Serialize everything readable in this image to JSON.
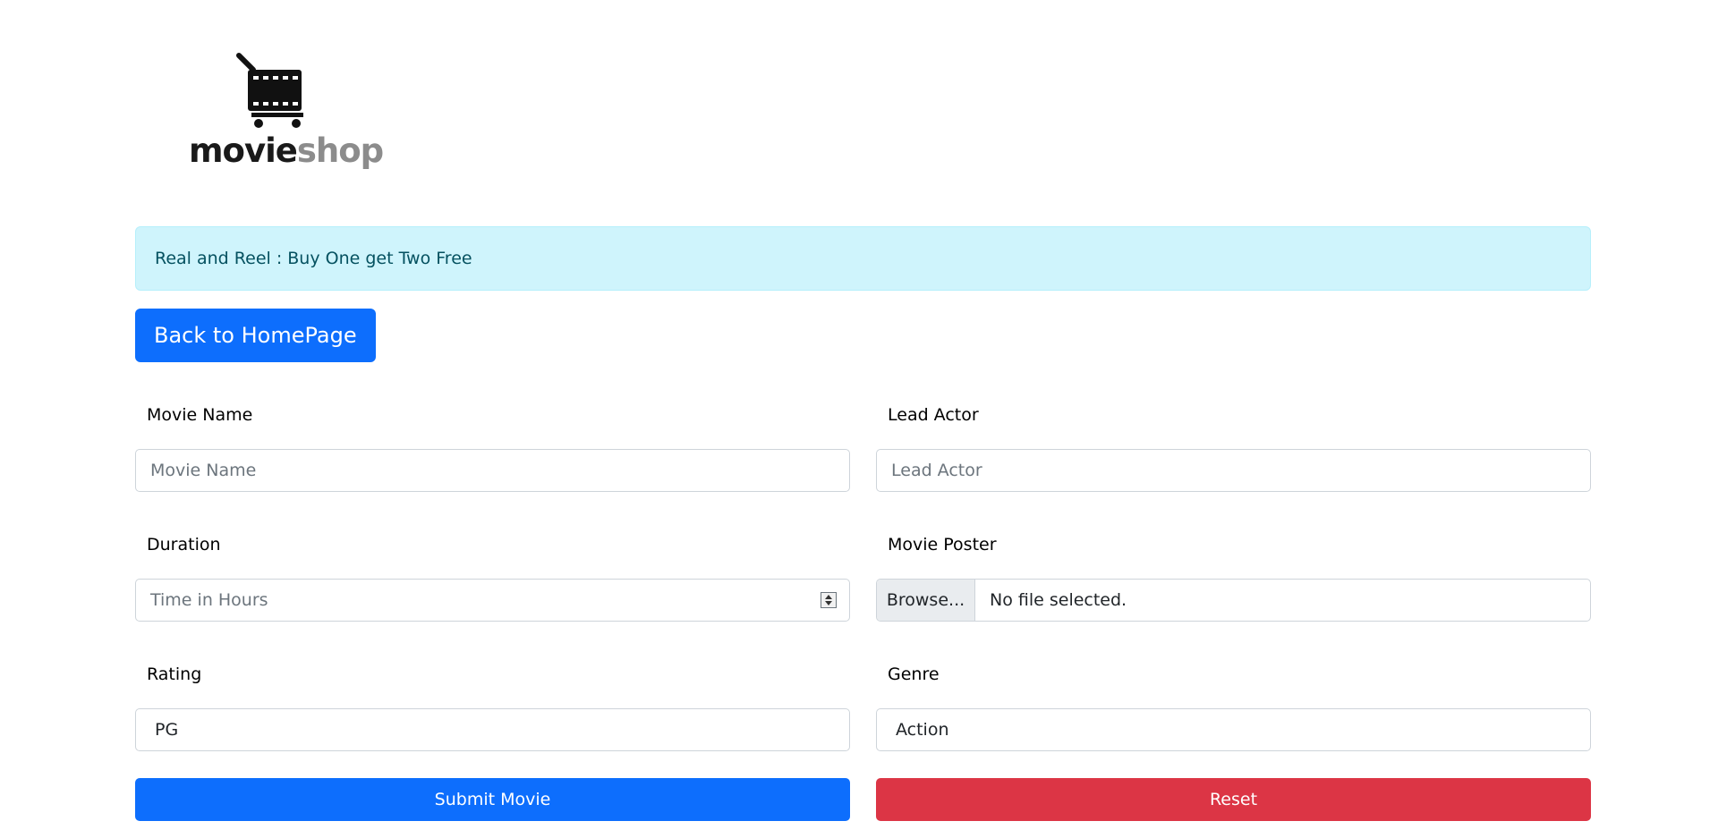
{
  "logo": {
    "text_movie": "movie",
    "text_shop": "shop"
  },
  "alert": {
    "text": "Real and Reel : Buy One get Two Free"
  },
  "back_button": {
    "label": "Back to HomePage"
  },
  "form": {
    "movie_name": {
      "label": "Movie Name",
      "placeholder": "Movie Name"
    },
    "lead_actor": {
      "label": "Lead Actor",
      "placeholder": "Lead Actor"
    },
    "duration": {
      "label": "Duration",
      "placeholder": "Time in Hours"
    },
    "movie_poster": {
      "label": "Movie Poster",
      "browse_label": "Browse...",
      "status": "No file selected."
    },
    "rating": {
      "label": "Rating",
      "value": "PG"
    },
    "genre": {
      "label": "Genre",
      "value": "Action"
    },
    "submit_label": "Submit Movie",
    "reset_label": "Reset"
  },
  "colors": {
    "primary": "#0d6efd",
    "danger": "#dc3545",
    "alert_bg": "#cff4fc",
    "alert_text": "#055160"
  },
  "icons": {
    "logo": "shopping-cart-film-icon",
    "spinner": "number-spinner-icon"
  }
}
